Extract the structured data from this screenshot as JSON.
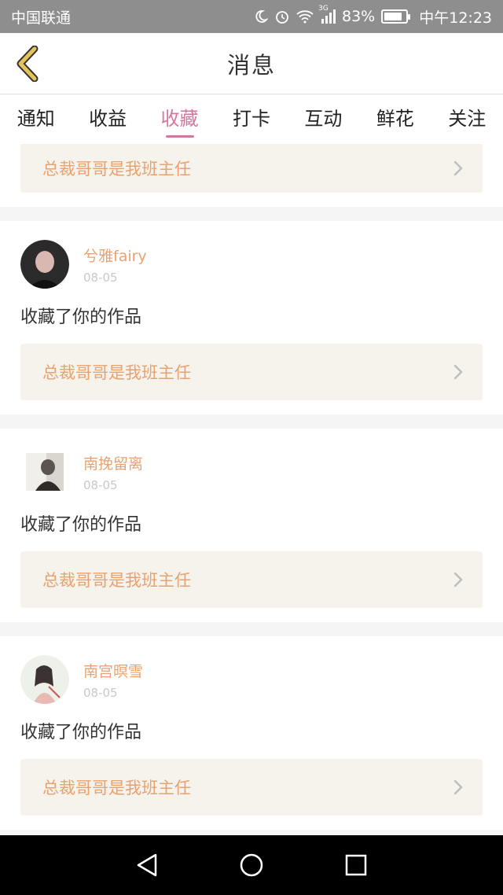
{
  "status_bar": {
    "carrier": "中国联通",
    "network": "3G",
    "battery": "83%",
    "battery_level": 0.83,
    "time": "中午12:23"
  },
  "header": {
    "title": "消息"
  },
  "tabs": [
    {
      "label": "通知",
      "active": false
    },
    {
      "label": "收益",
      "active": false
    },
    {
      "label": "收藏",
      "active": true
    },
    {
      "label": "打卡",
      "active": false
    },
    {
      "label": "互动",
      "active": false
    },
    {
      "label": "鲜花",
      "active": false
    },
    {
      "label": "关注",
      "active": false
    }
  ],
  "partial_card": {
    "work_title": "总裁哥哥是我班主任"
  },
  "cards": [
    {
      "user": "兮雅fairy",
      "date": "08-05",
      "message": "收藏了你的作品",
      "work_title": "总裁哥哥是我班主任"
    },
    {
      "user": "南挽留离",
      "date": "08-05",
      "message": "收藏了你的作品",
      "work_title": "总裁哥哥是我班主任"
    },
    {
      "user": "南宫暝雪",
      "date": "08-05",
      "message": "收藏了你的作品",
      "work_title": "总裁哥哥是我班主任"
    }
  ],
  "colors": {
    "accent_pink": "#d4779e",
    "username_orange": "#e8a271",
    "back_icon_gold": "#d9b24a"
  }
}
